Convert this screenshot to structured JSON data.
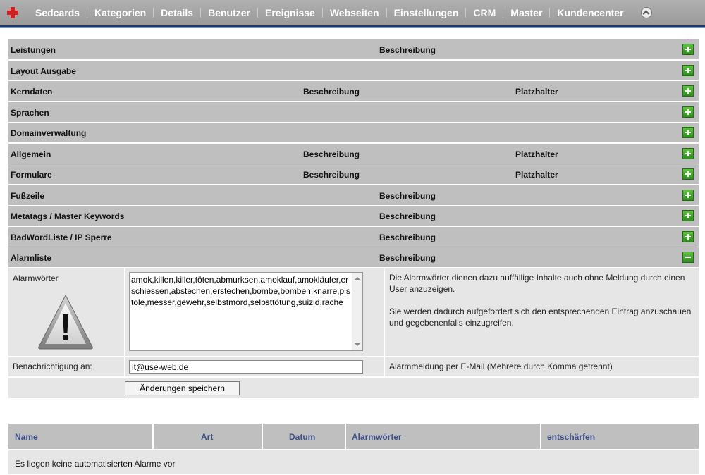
{
  "nav": {
    "items": [
      {
        "label": "Sedcards",
        "active": false
      },
      {
        "label": "Kategorien",
        "active": false
      },
      {
        "label": "Details",
        "active": false
      },
      {
        "label": "Benutzer",
        "active": false
      },
      {
        "label": "Ereignisse",
        "active": false
      },
      {
        "label": "Webseiten",
        "active": false
      },
      {
        "label": "Einstellungen",
        "active": true
      },
      {
        "label": "CRM",
        "active": false
      },
      {
        "label": "Master",
        "active": false
      },
      {
        "label": "Kundencenter",
        "active": false
      }
    ],
    "logo_icon": "red-cross-icon",
    "collapse_icon": "collapse-up-icon"
  },
  "sections": [
    {
      "title": "Leistungen",
      "desc": "Beschreibung",
      "ph": "",
      "layout": "mid",
      "expanded": false
    },
    {
      "title": "Layout Ausgabe",
      "desc": "",
      "ph": "",
      "layout": "none",
      "expanded": false
    },
    {
      "title": "Kerndaten",
      "desc": "Beschreibung",
      "ph": "Platzhalter",
      "layout": "three",
      "expanded": false
    },
    {
      "title": "Sprachen",
      "desc": "",
      "ph": "",
      "layout": "none",
      "expanded": false
    },
    {
      "title": "Domainverwaltung",
      "desc": "",
      "ph": "",
      "layout": "none",
      "expanded": false
    },
    {
      "title": "Allgemein",
      "desc": "Beschreibung",
      "ph": "Platzhalter",
      "layout": "three",
      "expanded": false
    },
    {
      "title": "Formulare",
      "desc": "Beschreibung",
      "ph": "Platzhalter",
      "layout": "three",
      "expanded": false
    },
    {
      "title": "Fußzeile",
      "desc": "Beschreibung",
      "ph": "",
      "layout": "mid",
      "expanded": false
    },
    {
      "title": "Metatags / Master Keywords",
      "desc": "Beschreibung",
      "ph": "",
      "layout": "mid",
      "expanded": false
    },
    {
      "title": "BadWordListe / IP Sperre",
      "desc": "Beschreibung",
      "ph": "",
      "layout": "mid",
      "expanded": false
    },
    {
      "title": "Alarmliste",
      "desc": "Beschreibung",
      "ph": "",
      "layout": "mid",
      "expanded": true
    }
  ],
  "alarm": {
    "words_label": "Alarmwörter",
    "words_value": "amok,killen,killer,töten,abmurksen,amoklauf,amokläufer,erschiessen,abstechen,erstechen,bombe,bomben,knarre,pistole,messer,gewehr,selbstmord,selbsttötung,suizid,rache",
    "words_hint_1": "Die Alarmwörter dienen dazu auffällige Inhalte auch ohne Meldung durch einen User anzuzeigen.",
    "words_hint_2": "Sie werden dadurch aufgefordert sich den entsprechenden Eintrag anzuschauen und gegebenenfalls einzugreifen.",
    "notify_label": "Benachrichtigung an:",
    "notify_value": "it@use-web.de",
    "notify_hint": "Alarmmeldung per E-Mail (Mehrere durch Komma getrennt)",
    "save_label": "Änderungen speichern",
    "warning_icon": "warning-icon"
  },
  "alarm_table": {
    "headers": [
      "Name",
      "Art",
      "Datum",
      "Alarmwörter",
      "entschärfen"
    ],
    "empty_text": "Es liegen keine automatisierten Alarme vor"
  },
  "colors": {
    "nav_bg": "#a6a6a6",
    "section_bg": "#bfbfbf",
    "panel_bg": "#e6e6e6",
    "accent_green": "#3fa52a",
    "header_text": "#3b4f86"
  }
}
